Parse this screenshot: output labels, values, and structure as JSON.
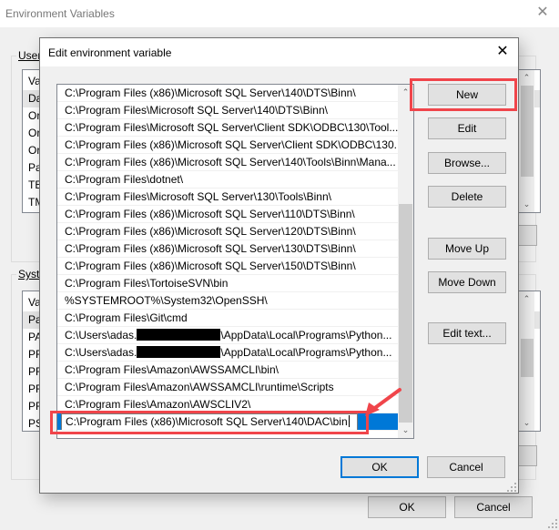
{
  "background_window": {
    "title": "Environment Variables",
    "close_glyph": "✕",
    "user_group_label": "User",
    "user_list_rows": [
      "Va",
      "Da",
      "Or",
      "Or",
      "Or",
      "Pa",
      "TE",
      "TM"
    ],
    "system_group_label": "System",
    "system_list_rows": [
      "Va",
      "Pa",
      "PA",
      "PR",
      "PR",
      "PR",
      "PR",
      "PS"
    ],
    "ok_label": "OK",
    "cancel_label": "Cancel"
  },
  "dialog": {
    "title": "Edit environment variable",
    "close_glyph": "✕",
    "paths": [
      "C:\\Program Files (x86)\\Microsoft SQL Server\\140\\DTS\\Binn\\",
      "C:\\Program Files\\Microsoft SQL Server\\140\\DTS\\Binn\\",
      "C:\\Program Files\\Microsoft SQL Server\\Client SDK\\ODBC\\130\\Tool...",
      "C:\\Program Files (x86)\\Microsoft SQL Server\\Client SDK\\ODBC\\130...",
      "C:\\Program Files (x86)\\Microsoft SQL Server\\140\\Tools\\Binn\\Mana...",
      "C:\\Program Files\\dotnet\\",
      "C:\\Program Files\\Microsoft SQL Server\\130\\Tools\\Binn\\",
      "C:\\Program Files (x86)\\Microsoft SQL Server\\110\\DTS\\Binn\\",
      "C:\\Program Files (x86)\\Microsoft SQL Server\\120\\DTS\\Binn\\",
      "C:\\Program Files (x86)\\Microsoft SQL Server\\130\\DTS\\Binn\\",
      "C:\\Program Files (x86)\\Microsoft SQL Server\\150\\DTS\\Binn\\",
      "C:\\Program Files\\TortoiseSVN\\bin",
      "%SYSTEMROOT%\\System32\\OpenSSH\\",
      "C:\\Program Files\\Git\\cmd"
    ],
    "redacted_paths": [
      {
        "prefix": "C:\\Users\\adas.",
        "suffix": "\\AppData\\Local\\Programs\\Python..."
      },
      {
        "prefix": "C:\\Users\\adas.",
        "suffix": "\\AppData\\Local\\Programs\\Python..."
      }
    ],
    "paths_after": [
      "C:\\Program Files\\Amazon\\AWSSAMCLI\\bin\\",
      "C:\\Program Files\\Amazon\\AWSSAMCLI\\runtime\\Scripts",
      "C:\\Program Files\\Amazon\\AWSCLIV2\\"
    ],
    "editing_value": "C:\\Program Files (x86)\\Microsoft SQL Server\\140\\DAC\\bin",
    "buttons": {
      "new": "New",
      "edit": "Edit",
      "browse": "Browse...",
      "delete": "Delete",
      "move_up": "Move Up",
      "move_down": "Move Down",
      "edit_text": "Edit text...",
      "ok": "OK",
      "cancel": "Cancel"
    },
    "scroll_up_glyph": "⌃",
    "scroll_down_glyph": "⌄"
  },
  "colors": {
    "annotation_red": "#f0454b",
    "selection_blue": "#0078d7"
  }
}
